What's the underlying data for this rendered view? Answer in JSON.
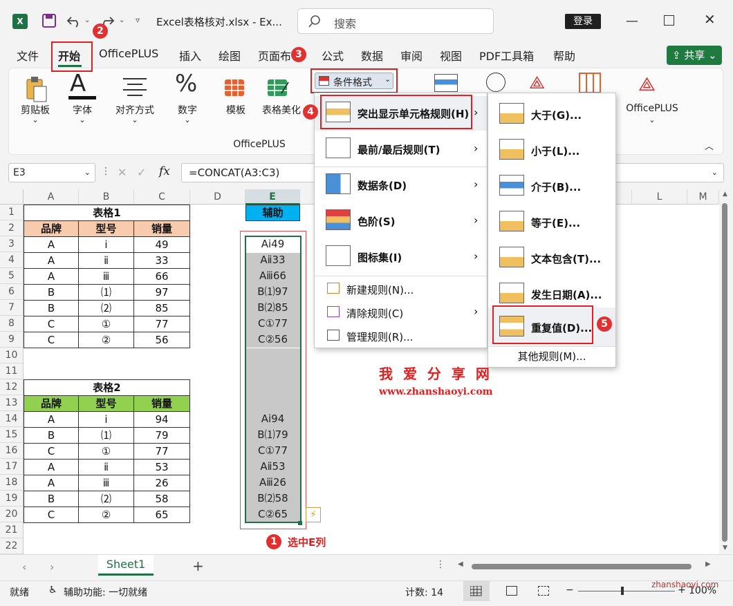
{
  "title_bar": {
    "file_title": "Excel表格核对.xlsx  -  Ex...",
    "search_placeholder": "搜索",
    "login_label": "登录"
  },
  "menu": {
    "items": [
      "文件",
      "开始",
      "OfficePLUS",
      "插入",
      "绘图",
      "页面布",
      "公式",
      "数据",
      "审阅",
      "视图",
      "PDF工具箱",
      "帮助"
    ],
    "share_label": "共享"
  },
  "ribbon": {
    "buttons": [
      "剪贴板",
      "字体",
      "对齐方式",
      "数字",
      "模板",
      "表格美化",
      "OfficePLUS"
    ],
    "group_label": "OfficePLUS",
    "conditional_format_label": "条件格式"
  },
  "formula_bar": {
    "name_box": "E3",
    "formula": "=CONCAT(A3:C3)"
  },
  "sheet": {
    "columns": [
      "A",
      "B",
      "C",
      "D",
      "E",
      "",
      "",
      "",
      "",
      "",
      "",
      "L",
      "M"
    ],
    "rows": [
      "1",
      "2",
      "3",
      "4",
      "5",
      "6",
      "7",
      "8",
      "9",
      "10",
      "11",
      "12",
      "13",
      "14",
      "15",
      "16",
      "17",
      "18",
      "19",
      "20",
      "21",
      "22"
    ],
    "table1_title": "表格1",
    "table2_title": "表格2",
    "headers": [
      "品牌",
      "型号",
      "销量"
    ],
    "helper_header": "辅助",
    "table1_rows": [
      [
        "A",
        "ⅰ",
        "49"
      ],
      [
        "A",
        "ⅱ",
        "33"
      ],
      [
        "A",
        "ⅲ",
        "66"
      ],
      [
        "B",
        "⑴",
        "97"
      ],
      [
        "B",
        "⑵",
        "85"
      ],
      [
        "C",
        "①",
        "77"
      ],
      [
        "C",
        "②",
        "56"
      ]
    ],
    "table2_rows": [
      [
        "A",
        "ⅰ",
        "94"
      ],
      [
        "B",
        "⑴",
        "79"
      ],
      [
        "C",
        "①",
        "77"
      ],
      [
        "A",
        "ⅱ",
        "53"
      ],
      [
        "A",
        "ⅲ",
        "26"
      ],
      [
        "B",
        "⑵",
        "58"
      ],
      [
        "C",
        "②",
        "65"
      ]
    ],
    "helper_values_1": [
      "Aⅰ49",
      "Aⅱ33",
      "Aⅲ66",
      "B⑴97",
      "B⑵85",
      "C①77",
      "C②56"
    ],
    "helper_values_2": [
      "Aⅰ94",
      "B⑴79",
      "C①77",
      "Aⅱ53",
      "Aⅲ26",
      "B⑵58",
      "C②65"
    ],
    "select_note": "选中E列"
  },
  "watermark": {
    "cn": "我 爱 分 享 网",
    "url": "www.zhanshaoyi.com",
    "corner": "zhanshaoyi.com"
  },
  "dropdown_main": {
    "items": [
      {
        "label": "突出显示单元格规则(H)",
        "bold": true
      },
      {
        "label": "最前/最后规则(T)",
        "bold": true
      },
      {
        "label": "数据条(D)",
        "bold": true
      },
      {
        "label": "色阶(S)",
        "bold": true
      },
      {
        "label": "图标集(I)",
        "bold": true
      },
      {
        "label": "新建规则(N)...",
        "bold": false
      },
      {
        "label": "清除规则(C)",
        "bold": false
      },
      {
        "label": "管理规则(R)...",
        "bold": false
      }
    ]
  },
  "dropdown_sub": {
    "items": [
      "大于(G)...",
      "小于(L)...",
      "介于(B)...",
      "等于(E)...",
      "文本包含(T)...",
      "发生日期(A)...",
      "重复值(D)..."
    ],
    "other": "其他规则(M)..."
  },
  "badges": [
    "1",
    "2",
    "3",
    "4",
    "5"
  ],
  "sheet_tabs": {
    "active": "Sheet1"
  },
  "status": {
    "ready": "就绪",
    "accessibility": "辅助功能: 一切就绪",
    "count": "计数: 14",
    "zoom": "100%"
  }
}
